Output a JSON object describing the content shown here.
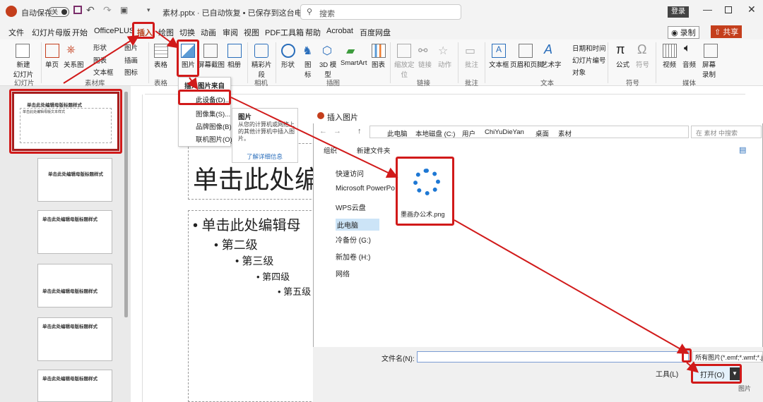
{
  "titlebar": {
    "autosave": "自动保存",
    "toggle": "关",
    "filename": "素材.pptx · 已自动恢复 • 已保存到这台电脑",
    "search_placeholder": "搜索",
    "login": "登录"
  },
  "menu": {
    "tabs": [
      "文件",
      "幻灯片母版",
      "开始",
      "OfficePLUS",
      "插入",
      "绘图",
      "切换",
      "动画",
      "审阅",
      "视图",
      "PDF工具箱",
      "帮助",
      "Acrobat",
      "百度网盘"
    ],
    "record": "录制",
    "share": "共享"
  },
  "ribbon": {
    "slides": {
      "new_slide": "新建\n幻灯片",
      "group": "幻灯片"
    },
    "material": {
      "single": "单页",
      "relation": "关系图",
      "shape": "形状",
      "chart": "图表",
      "textbox": "文本框",
      "icon": "图标",
      "illustration": "插画",
      "image": "图片",
      "group": "素材库"
    },
    "tables": {
      "table": "表格",
      "group": "表格"
    },
    "images": {
      "picture": "图片",
      "screenshot": "屏幕截图",
      "album": "相册",
      "group": "图像"
    },
    "camera": {
      "cameo": "精彩片\n段",
      "group": "相机"
    },
    "illus": {
      "shapes": "形状",
      "icons": "图\n标",
      "3d": "3D 模\n型",
      "smartart": "SmartArt",
      "chart": "图表",
      "group": "插图"
    },
    "links": {
      "zoom": "缩放定\n位",
      "link": "链接",
      "action": "动作",
      "group": "链接"
    },
    "comments": {
      "comment": "批注",
      "group": "批注"
    },
    "text": {
      "textbox": "文本框",
      "headerfooter": "页眉和页脚",
      "wordart": "艺术字",
      "datetime": "日期和时间",
      "slidenum": "幻灯片编号",
      "object": "对象",
      "group": "文本"
    },
    "symbols": {
      "equation": "公式",
      "symbol": "符号",
      "group": "符号"
    },
    "media": {
      "video": "视频",
      "audio": "音频",
      "screenrec": "屏幕\n录制",
      "group": "媒体"
    }
  },
  "dropdown": {
    "header": "插入图片来自",
    "items": [
      "此设备(D)...",
      "图像集(S)...",
      "品牌图像(B)...",
      "联机图片(O)..."
    ]
  },
  "tooltip": {
    "title": "图片",
    "body": "从您的计算机或网络上的其他计算机中插入图片。",
    "link": "了解详细信息"
  },
  "slides": {
    "master_title": "单击此处编辑母版标题样式",
    "master_sub": "单击此处编辑母版文本样式",
    "levels": [
      "第二级",
      "第三级",
      "第四级",
      "第五级"
    ],
    "thumb_titles": [
      "单击此处编辑母版标题样式",
      "单击此处编辑母版标题样式",
      "单击此处编辑母版标题样式",
      "单击此处编辑母版标题样式",
      "单击此处编辑母版标题样式",
      "单击此处编辑母版标题样式"
    ]
  },
  "slide_main": {
    "title": "单击此处编",
    "body": "• 单击此处编辑母",
    "levels": [
      "• 第二级",
      "• 第三级",
      "• 第四级",
      "• 第五级"
    ]
  },
  "dialog": {
    "title": "插入图片",
    "path": [
      "此电脑",
      "本地磁盘 (C:)",
      "用户",
      "ChiYuDieYan",
      "桌面",
      "素材"
    ],
    "search_placeholder": "在 素材 中搜索",
    "organize": "组织",
    "new_folder": "新建文件夹",
    "nav": [
      "快速访问",
      "Microsoft PowerPo",
      "WPS云盘",
      "此电脑",
      "冷备份 (G:)",
      "新加卷 (H:)",
      "网络"
    ],
    "file": "墨画办公术.png",
    "filename_label": "文件名(N):",
    "filter": "所有图片(*.emf;*.wmf;*.jp",
    "tools": "工具(L)",
    "open": "打开(O)",
    "right_label": "图片"
  },
  "colors": {
    "accent": "#d11a1a",
    "ppt_red": "#c43e1c",
    "file_icon": "#1e78d4"
  }
}
